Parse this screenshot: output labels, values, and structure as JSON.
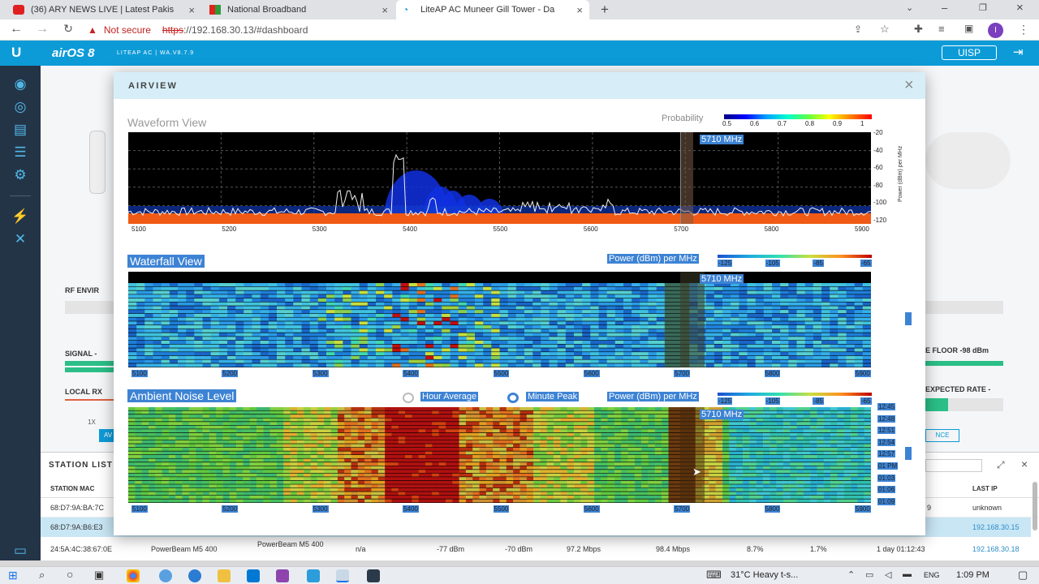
{
  "browser": {
    "tabs": [
      {
        "title": "(36) ARY NEWS LIVE | Latest Pakis"
      },
      {
        "title": "National Broadband"
      },
      {
        "title": "LiteAP AC Muneer Gill Tower - Da"
      }
    ],
    "new_tab": "+",
    "security": "Not secure",
    "url_scheme": "https",
    "url_rest": "://192.168.30.13/#dashboard",
    "profile_initial": "I"
  },
  "app": {
    "logo": "U",
    "product": "airOS 8",
    "device": "LITEAP AC | WA.V8.7.9",
    "uisp": "UISP"
  },
  "background": {
    "rf_env": "RF ENVIR",
    "signal": "SIGNAL -",
    "local_rx": "LOCAL RX",
    "onex": "1X",
    "noise_floor": "E FLOOR -98 dBm",
    "expected_rate": "EXPECTED RATE -",
    "nce": "NCE",
    "av": "AV"
  },
  "modal": {
    "title": "AIRVIEW",
    "close": "×",
    "waveform": {
      "title": "Waveform View",
      "probability_label": "Probability",
      "prob_ticks": [
        "0.5",
        "0.6",
        "0.7",
        "0.8",
        "0.9",
        "1"
      ],
      "marker": "5710 MHz",
      "y_ticks": [
        "-20",
        "-40",
        "-60",
        "-80",
        "-100",
        "-120"
      ],
      "y_label": "Power (dBm) per MHz",
      "x_ticks": [
        "5100",
        "5200",
        "5300",
        "5400",
        "5500",
        "5600",
        "5700",
        "5800",
        "5900"
      ]
    },
    "waterfall": {
      "title": "Waterfall View",
      "power_label": "Power (dBm) per MHz",
      "scale_ticks": [
        "-125",
        "-105",
        "-85",
        "-65"
      ],
      "marker": "5710 MHz",
      "x_ticks": [
        "5100",
        "5200",
        "5300",
        "5400",
        "5500",
        "5600",
        "5700",
        "5800",
        "5900"
      ]
    },
    "ambient": {
      "title": "Ambient Noise Level",
      "hour_average": "Hour Average",
      "minute_peak": "Minute Peak",
      "power_label": "Power (dBm) per MHz",
      "scale_ticks": [
        "-125",
        "-105",
        "-85",
        "-65"
      ],
      "marker": "5710 MHz",
      "times": [
        "12:45",
        "12:48",
        "12:51",
        "12:54",
        "12:57",
        "01 PM",
        "01:03",
        "01:06",
        "01:09"
      ],
      "x_ticks": [
        "5100",
        "5200",
        "5300",
        "5400",
        "5500",
        "5600",
        "5700",
        "5800",
        "5900"
      ]
    }
  },
  "station_list": {
    "title": "STATION LIST",
    "headers": {
      "mac": "STATION MAC",
      "last_ip": "LAST IP"
    },
    "rows": [
      {
        "mac": "68:D7:9A:BA:7C",
        "col9": "9",
        "last_ip": "unknown"
      },
      {
        "mac": "68:D7:9A:B6:E3",
        "col9": "",
        "last_ip": "192.168.30.15"
      },
      {
        "mac": "24:5A:4C:38:67:0E",
        "device": "PowerBeam M5 400",
        "name": "PowerBeam M5 400",
        "n_a": "n/a",
        "signal": "-77 dBm",
        "rssi": "-70 dBm",
        "tx": "97.2 Mbps",
        "rx": "98.4 Mbps",
        "p1": "8.7%",
        "p2": "1.7%",
        "uptime": "1 day 01:12:43",
        "last_ip": "192.168.30.18"
      }
    ]
  },
  "taskbar": {
    "weather": "31°C  Heavy t-s...",
    "lang": "ENG",
    "time": "1:09 PM"
  },
  "colors": {
    "accent": "#0d9bd8",
    "sidebar": "#243447",
    "selection": "#3d83d4"
  }
}
